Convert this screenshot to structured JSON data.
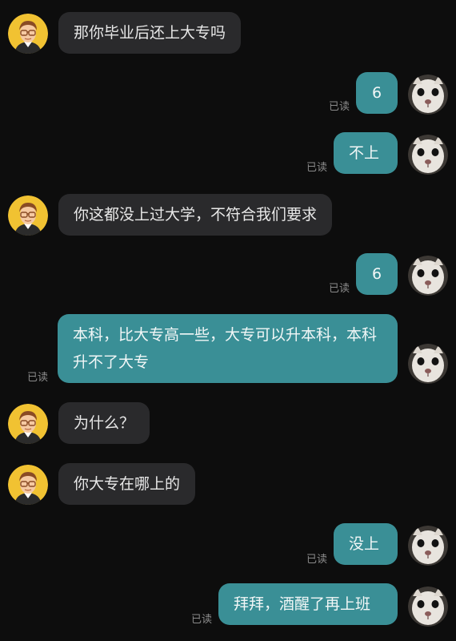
{
  "chat": {
    "read_label": "已读",
    "messages": [
      {
        "side": "in",
        "text": "那你毕业后还上大专吗"
      },
      {
        "side": "out",
        "text": "6"
      },
      {
        "side": "out",
        "text": "不上"
      },
      {
        "side": "in",
        "text": "你这都没上过大学，不符合我们要求"
      },
      {
        "side": "out",
        "text": "6"
      },
      {
        "side": "out",
        "text": "本科，比大专高一些，大专可以升本科，本科升不了大专"
      },
      {
        "side": "in",
        "text": "为什么？"
      },
      {
        "side": "in",
        "text": "你大专在哪上的"
      },
      {
        "side": "out",
        "text": "没上"
      },
      {
        "side": "out",
        "text": "拜拜，酒醒了再上班"
      }
    ]
  },
  "colors": {
    "background": "#0d0d0d",
    "incoming_bubble": "#2a2a2c",
    "outgoing_bubble": "#3a8f96",
    "read_receipt": "#8a8a8a"
  },
  "icons": {
    "incoming_avatar": "cartoon-man-avatar-icon",
    "outgoing_avatar": "cat-face-avatar-icon"
  }
}
